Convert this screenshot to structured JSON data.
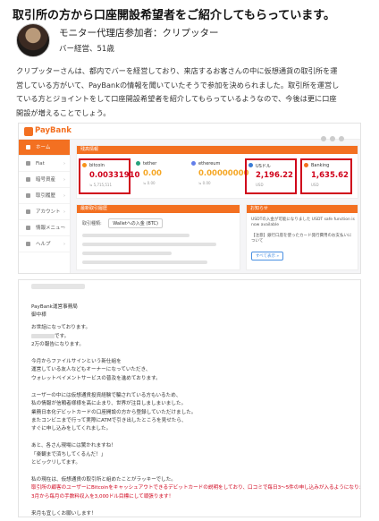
{
  "article": {
    "headline": "取引所の方から口座開設希望者をご紹介してもらっています。",
    "profile": {
      "name": "モニター代理店参加者：クリプッター",
      "sub": "バー経営、51歳"
    },
    "intro_lines": [
      "クリプッターさんは、都内でバーを経営しており、来店するお客さんの中に仮想通貨の取引所を運",
      "営している方がいて、PayBankの情報を聞いていたそうで参加を決められました。取引所を運営し",
      "ている方とジョイントをして口座開設希望者を紹介してもらっているようなので、今後は更に口座",
      "開設が増えることでしょう。"
    ]
  },
  "dashboard": {
    "logo_text": "PayBank",
    "nav": [
      {
        "label": "ホーム",
        "icon": "home-icon",
        "active": true
      },
      {
        "label": "Fiat",
        "icon": "fiat-icon",
        "active": false
      },
      {
        "label": "暗号資産",
        "icon": "crypto-icon",
        "active": false
      },
      {
        "label": "取引履歴",
        "icon": "history-icon",
        "active": false
      },
      {
        "label": "アカウント",
        "icon": "account-icon",
        "active": false
      },
      {
        "label": "情報メニュー",
        "icon": "info-icon",
        "active": false
      },
      {
        "label": "ヘルプ",
        "icon": "help-icon",
        "active": false
      }
    ],
    "assets_header": "残高情報",
    "assets": [
      {
        "name": "bitcoin",
        "value": "0.00331910",
        "sub": "≒ 5,715,511",
        "color": "#d0021b",
        "highlighted": true,
        "dot": "#f7931a"
      },
      {
        "name": "tether",
        "value": "0.00",
        "sub": "≒ 0.00",
        "color": "#f5a623",
        "highlighted": false,
        "dot": "#26a17b"
      },
      {
        "name": "ethereum",
        "value": "0.00000000",
        "sub": "≒ 0.00",
        "color": "#f5a623",
        "highlighted": false,
        "dot": "#627eea"
      },
      {
        "name": "USドル",
        "value": "2,196.22",
        "sub": "USD",
        "color": "#d0021b",
        "highlighted": true,
        "dot": "#3a7bd5"
      },
      {
        "name": "Banking",
        "value": "1,635.62",
        "sub": "USD",
        "color": "#d0021b",
        "highlighted": true,
        "dot": "#f37021"
      }
    ],
    "trade_header": "最新取引履歴",
    "trade_label": "取引種類:",
    "trade_select": "Walletへの入金 (BTC)",
    "notice_header": "お知らせ",
    "notices": [
      "USDTの入金が可能になりました USDT safe function is now available",
      "【注意】銀行口座を使ったカード発行費用のお支払いについて"
    ],
    "notice_button": "すべて表示 »"
  },
  "email": {
    "lines": [
      {
        "text": "PayBank運営事務局",
        "red": false
      },
      {
        "text": "御中様",
        "red": false
      },
      {
        "text": "お世話になっております。",
        "red": false
      },
      {
        "text": "です。",
        "red": false,
        "redact": true
      },
      {
        "text": "2万の報告になります。",
        "red": false
      },
      {
        "text": "今月からファイルサインという新仕組を",
        "red": false
      },
      {
        "text": "運営している友人などもオーナーになっていただき、",
        "red": false
      },
      {
        "text": "ウォレットペイメントサービスの普及を進めております。",
        "red": false
      },
      {
        "text": "ユーザーの中には仮想通貨投資経験で騙されている方もいるため、",
        "red": false
      },
      {
        "text": "私の情報が信頼者様様を高に止まり、世界が注目しましまいました。",
        "red": false
      },
      {
        "text": "業務日本化デビットカードの口座開設の方から登録していただけました。",
        "red": false
      },
      {
        "text": "またコンビニまで行って実際にATMで引き出したところを見せたら、",
        "red": false
      },
      {
        "text": "すぐに申し込みをしてくれました。",
        "red": false
      },
      {
        "text": "あと、各さん現場には驚かれますね！",
        "red": false
      },
      {
        "text": "「楽観まで済ちしてくるんだ！」",
        "red": false
      },
      {
        "text": "とビックリしてます。",
        "red": false
      },
      {
        "text": "私の現在は、仮想通貨の取引所と組めたことがラッキーでした。",
        "red": false
      },
      {
        "text": "取引所の顧客のユーザーにBitcoinをキャッシュアウトできるデビットカードの説明をしており、口コミで毎日3〜5件の申し込みが入るようになりました。",
        "red": true
      },
      {
        "text": "3月から毎月の手数料収入を3,000ドル目標にして頑張ります！",
        "red": true
      },
      {
        "text": "来月も宜しくお願いします！",
        "red": false
      }
    ]
  }
}
